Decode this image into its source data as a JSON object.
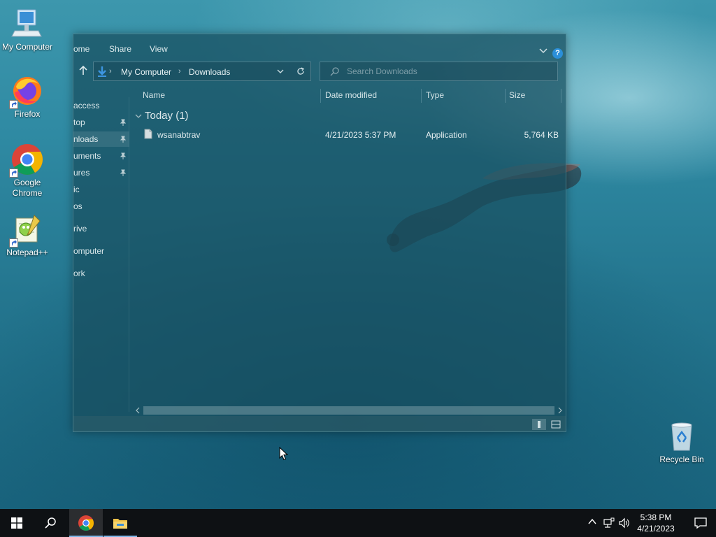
{
  "desktop": {
    "icons": [
      {
        "label": "My Computer",
        "icon": "computer-icon"
      },
      {
        "label": "Firefox",
        "icon": "firefox-icon"
      },
      {
        "label": "Google Chrome",
        "icon": "chrome-icon"
      },
      {
        "label": "Notepad++",
        "icon": "notepad-plus-plus-icon"
      },
      {
        "label": "Recycle Bin",
        "icon": "recycle-bin-icon"
      }
    ]
  },
  "explorer": {
    "ribbon_tabs": [
      "ome",
      "Share",
      "View"
    ],
    "breadcrumb": [
      "My Computer",
      "Downloads"
    ],
    "search_placeholder": "Search Downloads",
    "nav_items": [
      {
        "label": "access",
        "pinned": false
      },
      {
        "label": "top",
        "pinned": true
      },
      {
        "label": "nloads",
        "pinned": true,
        "selected": true
      },
      {
        "label": "uments",
        "pinned": true
      },
      {
        "label": "ures",
        "pinned": true
      },
      {
        "label": "ic",
        "pinned": false
      },
      {
        "label": "os",
        "pinned": false
      },
      {
        "label": "rive",
        "pinned": false
      },
      {
        "label": "omputer",
        "pinned": false
      },
      {
        "label": "ork",
        "pinned": false
      }
    ],
    "columns": [
      "Name",
      "Date modified",
      "Type",
      "Size"
    ],
    "group_title": "Today (1)",
    "files": [
      {
        "name": "wsanabtrav",
        "date": "4/21/2023 5:37 PM",
        "type": "Application",
        "size": "5,764 KB"
      }
    ]
  },
  "taskbar": {
    "clock_time": "5:38 PM",
    "clock_date": "4/21/2023",
    "accent": "#7fb6e6"
  }
}
